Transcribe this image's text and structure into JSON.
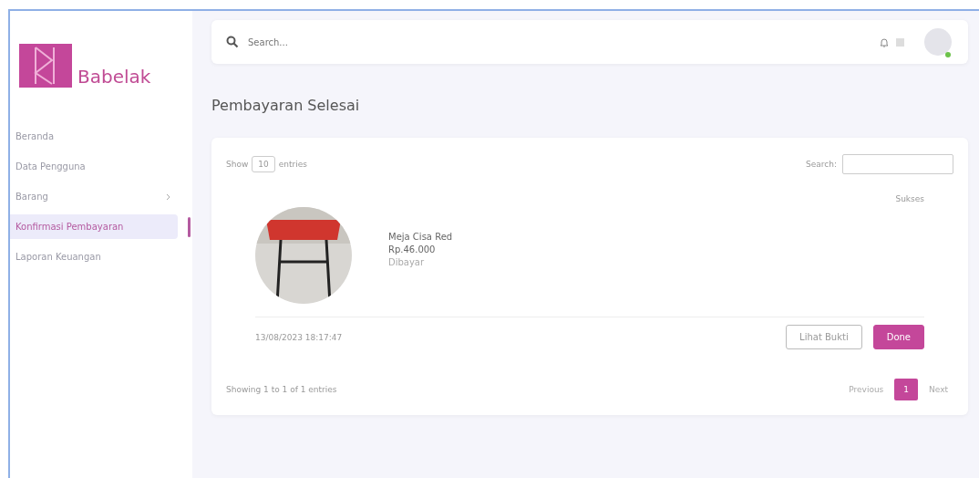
{
  "brand": {
    "name": "Babelak"
  },
  "sidebar": {
    "items": [
      {
        "label": "Beranda",
        "selected": false,
        "expandable": false
      },
      {
        "label": "Data Pengguna",
        "selected": false,
        "expandable": false
      },
      {
        "label": "Barang",
        "selected": false,
        "expandable": true
      },
      {
        "label": "Konfirmasi Pembayaran",
        "selected": true,
        "expandable": false
      },
      {
        "label": "Laporan Keuangan",
        "selected": false,
        "expandable": false
      }
    ]
  },
  "topbar": {
    "search": {
      "placeholder": "Search..."
    },
    "avatar": {
      "online": true
    }
  },
  "page_title": "Pembayaran Selesai",
  "table": {
    "length": {
      "before": "Show",
      "value": "10",
      "after": "entries"
    },
    "search_label": "Search:",
    "orders": [
      {
        "product": "Meja Cisa Red",
        "price": "Rp.46.000",
        "status": "Dibayar",
        "badge": "Sukses",
        "date": "13/08/2023 18:17:47",
        "actions": [
          "Lihat Bukti",
          "Done"
        ]
      }
    ],
    "info": "Showing 1 to 1 of 1 entries",
    "pagination": [
      {
        "label": "Previous",
        "kind": "nav",
        "selected": false
      },
      {
        "label": "1",
        "kind": "page",
        "selected": true
      },
      {
        "label": "Next",
        "kind": "nav",
        "selected": false
      }
    ]
  }
}
